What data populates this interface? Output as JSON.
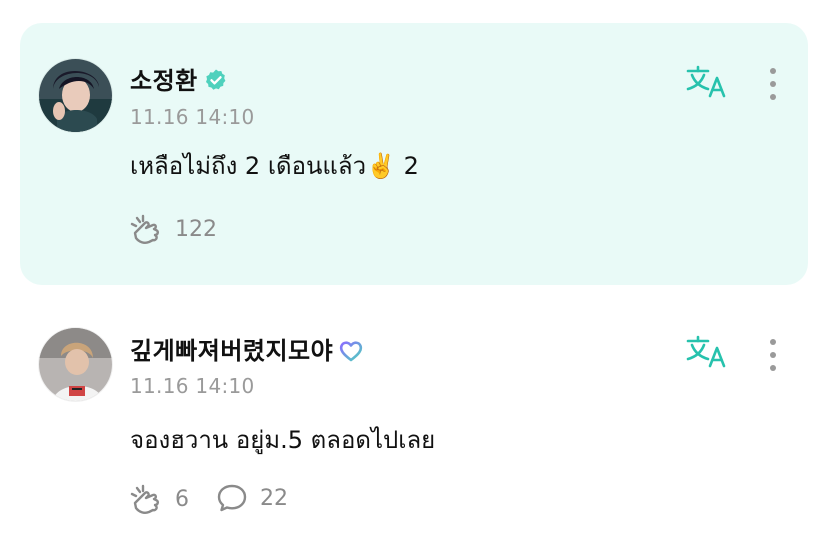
{
  "comments": [
    {
      "author": "소정환",
      "verified_badge": "verified-check-icon",
      "time": "11.16 14:10",
      "text": "เหลือไม่ถึง 2 เดือนแล้ว✌️ 2",
      "like_count": "122",
      "highlighted": true,
      "bg_color": "#e9faf7"
    },
    {
      "author": "깊게빠져버렸지모야",
      "membership_badge": "heart-badge-icon",
      "time": "11.16 14:10",
      "text": "จองฮวาน อยู่ม.5 ตลอดไปเลย",
      "like_count": "6",
      "reply_count": "22",
      "highlighted": false
    }
  ],
  "icons": {
    "translate": "translate-icon",
    "more": "more-vertical-icon",
    "like": "like-hand-icon",
    "reply": "reply-bubble-icon"
  },
  "colors": {
    "accent": "#27c2ad",
    "muted": "#9a9a9a"
  }
}
